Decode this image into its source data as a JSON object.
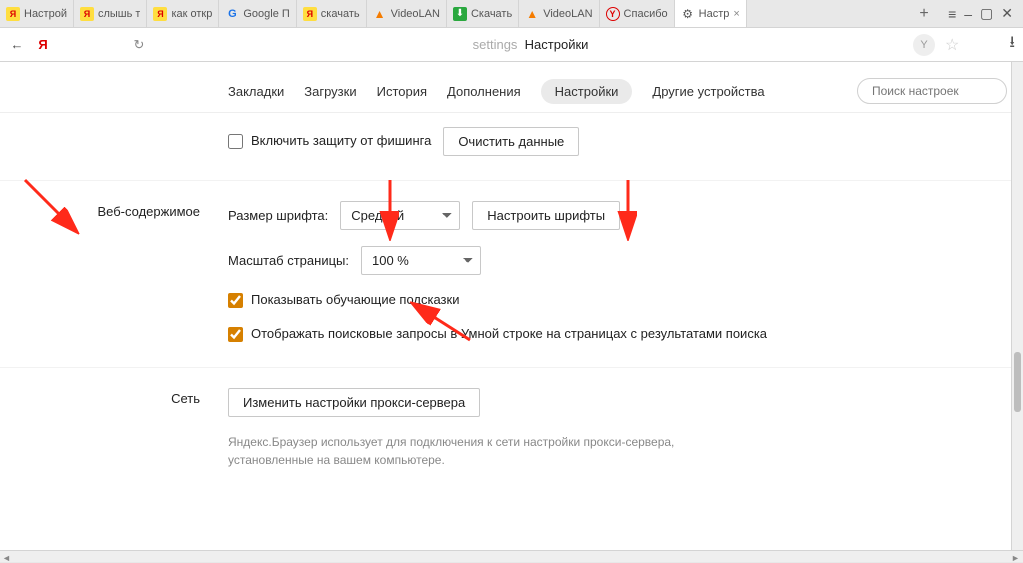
{
  "window": {
    "tabs": [
      {
        "favicon": "y",
        "title": "Настрой"
      },
      {
        "favicon": "y",
        "title": "слышь т"
      },
      {
        "favicon": "y",
        "title": "как откр"
      },
      {
        "favicon": "g",
        "title": "Google П"
      },
      {
        "favicon": "y",
        "title": "скачать"
      },
      {
        "favicon": "vlc",
        "title": "VideoLAN"
      },
      {
        "favicon": "dl",
        "title": "Скачать"
      },
      {
        "favicon": "vlc",
        "title": "VideoLAN"
      },
      {
        "favicon": "ycircle",
        "title": "Спасибо"
      },
      {
        "favicon": "gear",
        "title": "Настр",
        "active": true,
        "closable": true
      }
    ],
    "newtab": "+",
    "menu": "≡",
    "min": "‒",
    "max": "▢",
    "close": "✕"
  },
  "address": {
    "back": "←",
    "logo": "Я",
    "reload": "↻",
    "prefix": "settings",
    "title": "Настройки",
    "shield": "Y",
    "star": "☆",
    "download": "⭳"
  },
  "nav": {
    "items": [
      "Закладки",
      "Загрузки",
      "История",
      "Дополнения",
      "Настройки",
      "Другие устройства"
    ],
    "active_index": 4,
    "search_placeholder": "Поиск настроек"
  },
  "phishing": {
    "checkbox_label": "Включить защиту от фишинга",
    "clear_button": "Очистить данные"
  },
  "webcontent": {
    "section_title": "Веб-содержимое",
    "font_size_label": "Размер шрифта:",
    "font_size_value": "Средний",
    "customize_fonts_button": "Настроить шрифты",
    "page_zoom_label": "Масштаб страницы:",
    "page_zoom_value": "100 %",
    "show_hints_label": "Показывать обучающие подсказки",
    "smartline_label": "Отображать поисковые запросы в Умной строке на страницах с результатами поиска"
  },
  "network": {
    "section_title": "Сеть",
    "proxy_button": "Изменить настройки прокси-сервера",
    "hint": "Яндекс.Браузер использует для подключения к сети настройки прокси-сервера, установленные на вашем компьютере."
  }
}
